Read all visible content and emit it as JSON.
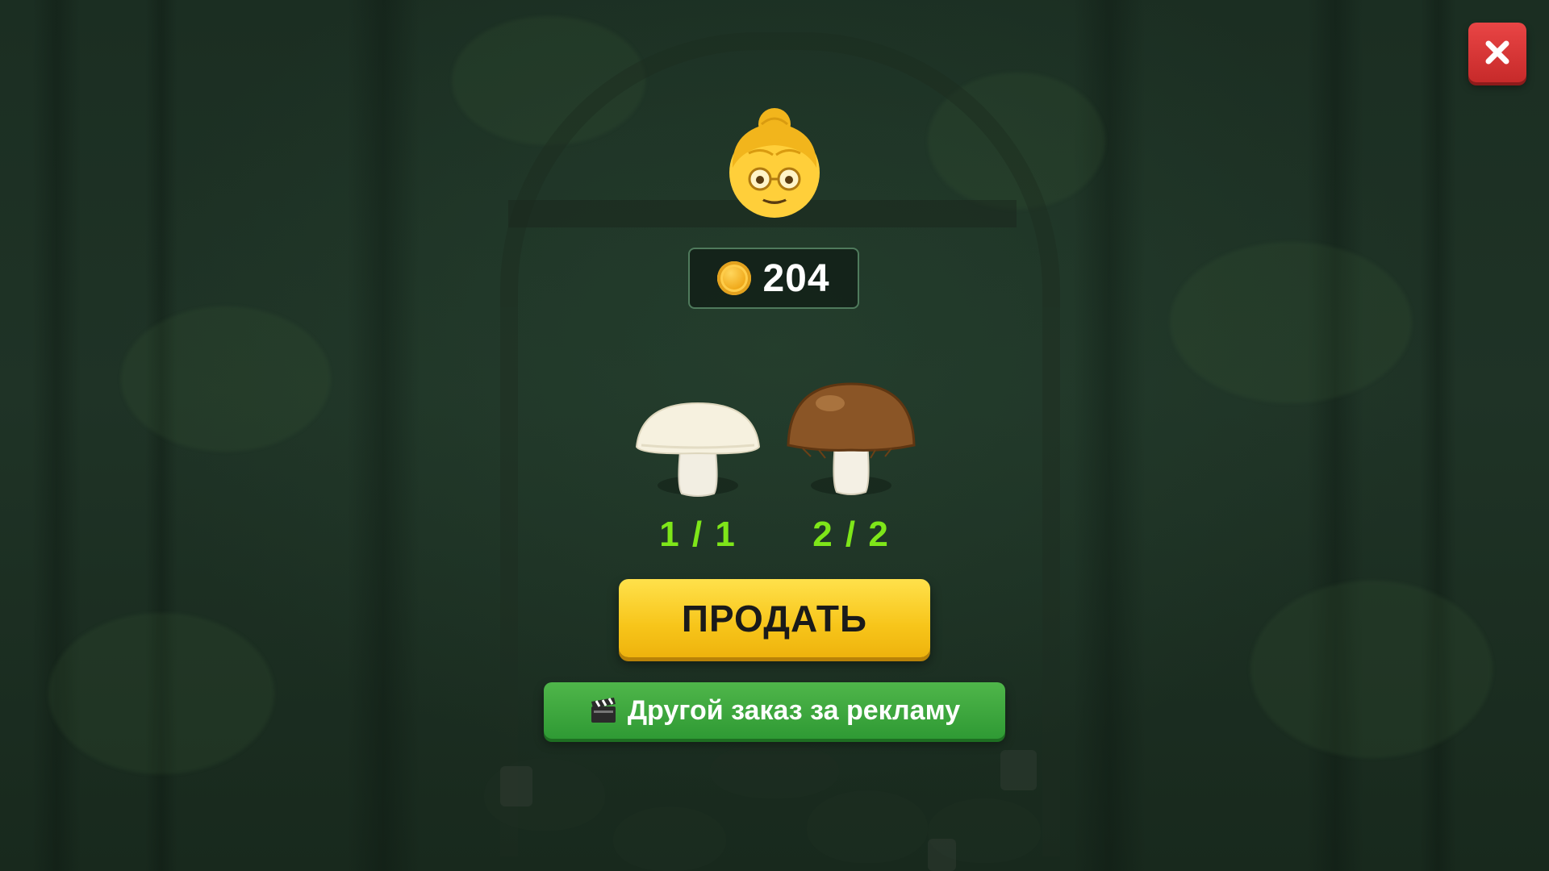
{
  "header": {
    "close_icon": "close-x-icon",
    "close_color": "#d93636"
  },
  "character": {
    "icon": "old-woman-emoji"
  },
  "balance": {
    "coin_icon": "gold-coin-icon",
    "value": "204"
  },
  "order": {
    "items": [
      {
        "icon": "white-mushroom-icon",
        "count": "1 / 1"
      },
      {
        "icon": "brown-mushroom-icon",
        "count": "2 / 2"
      }
    ]
  },
  "actions": {
    "sell_label": "ПРОДАТЬ",
    "ad_icon": "clapperboard-icon",
    "ad_label": "Другой заказ за рекламу"
  },
  "colors": {
    "count_green": "#7ee619",
    "sell_yellow": "#f7c51a",
    "ad_green": "#2f9a34"
  }
}
